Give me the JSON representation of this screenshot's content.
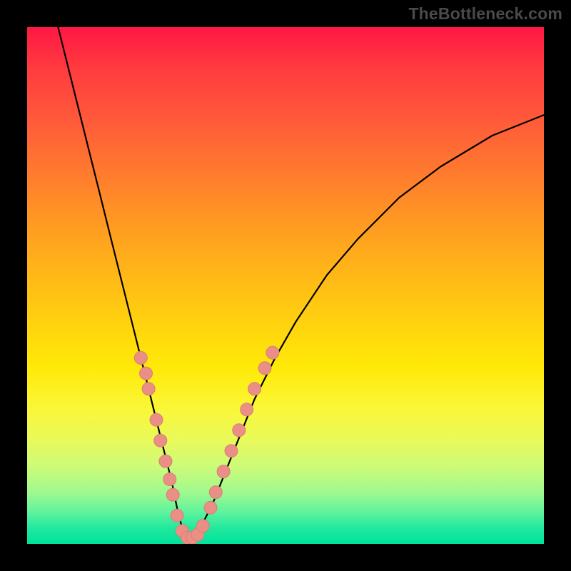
{
  "watermark": {
    "text": "TheBottleneck.com"
  },
  "colors": {
    "curve_stroke": "#000000",
    "marker_fill": "#e98f86",
    "marker_stroke": "#d97e75"
  },
  "chart_data": {
    "type": "line",
    "title": "",
    "xlabel": "",
    "ylabel": "",
    "xlim": [
      0,
      100
    ],
    "ylim": [
      0,
      100
    ],
    "note": "No numeric axis ticks or labels visible; values are pixel-normalized 0–100 percentages of the plot area. Lower y = closer to bottom (green / no-bottleneck). Curve minimum near x≈31.",
    "series": [
      {
        "name": "bottleneck-curve",
        "x": [
          6,
          8,
          10,
          12,
          14,
          16,
          18,
          20,
          22,
          24,
          26,
          28,
          29,
          30,
          31,
          32,
          33,
          34,
          36,
          38,
          40,
          44,
          48,
          52,
          58,
          64,
          72,
          80,
          90,
          100
        ],
        "y": [
          100,
          92,
          84,
          76,
          68,
          60,
          52,
          44,
          36,
          28,
          20,
          12,
          7,
          3,
          1,
          1,
          2,
          4,
          8,
          13,
          18,
          28,
          36,
          43,
          52,
          59,
          67,
          73,
          79,
          83
        ]
      }
    ],
    "markers": {
      "name": "highlighted-points",
      "note": "Salmon dots along the curve near the valley / lower arms.",
      "points": [
        {
          "x": 22.0,
          "y": 36.0
        },
        {
          "x": 23.0,
          "y": 33.0
        },
        {
          "x": 23.5,
          "y": 30.0
        },
        {
          "x": 25.0,
          "y": 24.0
        },
        {
          "x": 25.8,
          "y": 20.0
        },
        {
          "x": 26.8,
          "y": 16.0
        },
        {
          "x": 27.6,
          "y": 12.5
        },
        {
          "x": 28.2,
          "y": 9.5
        },
        {
          "x": 29.0,
          "y": 5.5
        },
        {
          "x": 30.0,
          "y": 2.5
        },
        {
          "x": 31.0,
          "y": 1.2
        },
        {
          "x": 32.0,
          "y": 1.2
        },
        {
          "x": 33.0,
          "y": 1.8
        },
        {
          "x": 34.0,
          "y": 3.5
        },
        {
          "x": 35.5,
          "y": 7.0
        },
        {
          "x": 36.5,
          "y": 10.0
        },
        {
          "x": 38.0,
          "y": 14.0
        },
        {
          "x": 39.5,
          "y": 18.0
        },
        {
          "x": 41.0,
          "y": 22.0
        },
        {
          "x": 42.5,
          "y": 26.0
        },
        {
          "x": 44.0,
          "y": 30.0
        },
        {
          "x": 46.0,
          "y": 34.0
        },
        {
          "x": 47.5,
          "y": 37.0
        }
      ]
    }
  }
}
